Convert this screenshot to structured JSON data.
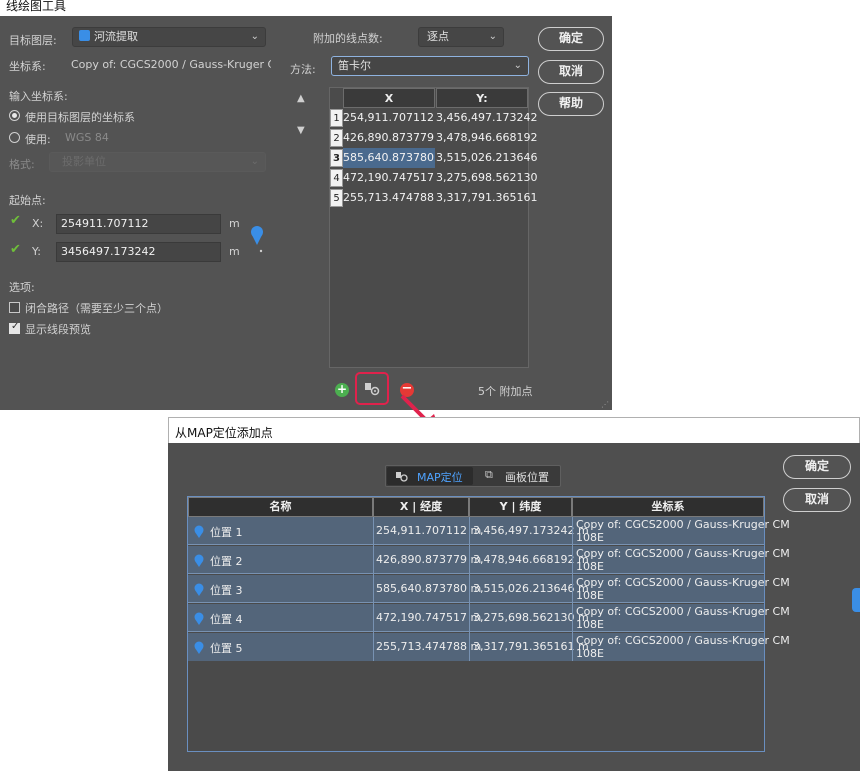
{
  "tool_title": "线绘图工具",
  "top": {
    "target_layer_label": "目标图层:",
    "target_layer_value": "河流提取",
    "coord_sys_label": "坐标系:",
    "coord_sys_value": "Copy of: CGCS2000 / Gauss-Kruger CM 1...",
    "input_cs_label": "输入坐标系:",
    "use_target_cs_label": "使用目标图层的坐标系",
    "use_label": "使用:",
    "use_value": "WGS 84",
    "format_label": "格式:",
    "format_value": "投影单位",
    "start_label": "起始点:",
    "x_label": "X:",
    "x_value": "254911.707112",
    "x_unit": "m",
    "y_label": "Y:",
    "y_value": "3456497.173242",
    "y_unit": "m",
    "options_label": "选项:",
    "close_path_label": "闭合路径（需要至少三个点）",
    "show_preview_label": "显示线段预览",
    "extra_points_label": "附加的线点数:",
    "extra_points_value": "逐点",
    "method_label": "方法:",
    "method_value": "笛卡尔",
    "ok_label": "确定",
    "cancel_label": "取消",
    "help_label": "帮助",
    "up_icon": "triangle-up",
    "down_icon": "triangle-down",
    "grid_headers": [
      "X",
      "Y:"
    ],
    "grid_rows": [
      {
        "n": "1",
        "x": "254,911.707112",
        "y": "3,456,497.173242"
      },
      {
        "n": "2",
        "x": "426,890.873779",
        "y": "3,478,946.668192"
      },
      {
        "n": "3",
        "x": "585,640.873780",
        "y": "3,515,026.213646"
      },
      {
        "n": "4",
        "x": "472,190.747517",
        "y": "3,275,698.562130"
      },
      {
        "n": "5",
        "x": "255,713.474788",
        "y": "3,317,791.365161"
      }
    ],
    "points_count": "5个 附加点"
  },
  "map_dialog": {
    "title": "从MAP定位添加点",
    "tab_map": "MAP定位",
    "tab_board": "画板位置",
    "ok_label": "确定",
    "cancel_label": "取消",
    "headers": [
      "名称",
      "X | 经度",
      "Y | 纬度",
      "坐标系"
    ],
    "rows": [
      {
        "name": "位置 1",
        "x": "254,911.707112 m",
        "y": "3,456,497.173242 m",
        "cs1": "Copy of: CGCS2000 / Gauss-Kruger CM",
        "cs2": "108E"
      },
      {
        "name": "位置 2",
        "x": "426,890.873779 m",
        "y": "3,478,946.668192 m",
        "cs1": "Copy of: CGCS2000 / Gauss-Kruger CM",
        "cs2": "108E"
      },
      {
        "name": "位置 3",
        "x": "585,640.873780 m",
        "y": "3,515,026.213646 m",
        "cs1": "Copy of: CGCS2000 / Gauss-Kruger CM",
        "cs2": "108E"
      },
      {
        "name": "位置 4",
        "x": "472,190.747517 m",
        "y": "3,275,698.562130 m",
        "cs1": "Copy of: CGCS2000 / Gauss-Kruger CM",
        "cs2": "108E"
      },
      {
        "name": "位置 5",
        "x": "255,713.474788 m",
        "y": "3,317,791.365161 m",
        "cs1": "Copy of: CGCS2000 / Gauss-Kruger CM",
        "cs2": "108E"
      }
    ]
  },
  "colors": {
    "accent": "#3a8ee6",
    "check": "#6fbf3a",
    "highlight": "#e0224c",
    "add": "#4caf50",
    "remove": "#e53935"
  }
}
